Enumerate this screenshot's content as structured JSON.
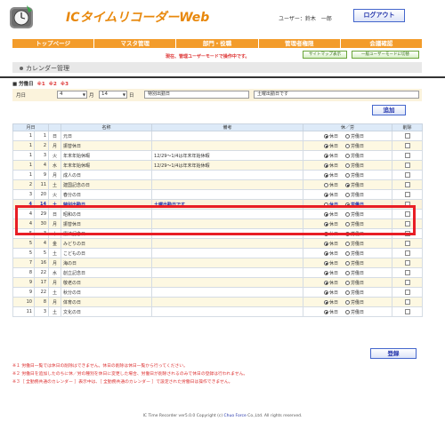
{
  "header": {
    "app_title": "ICタイムリコーダーWeb",
    "user_label": "ユーザー：鈴木　一郎",
    "logout_label": "ログアウト"
  },
  "nav": {
    "items": [
      "トップページ",
      "マスタ管理",
      "部門・役職",
      "管理者権限",
      "会議確認"
    ]
  },
  "toolbar": {
    "notice": "現在、管理ユーザーモードで操作中です。",
    "sitemap_label": "サイトマップ表示",
    "switch_label": "一般ユーザーモードに切替"
  },
  "page": {
    "section_title": "カレンダー管理",
    "legend_title": "■ 労働日",
    "legend_refs": [
      "※1",
      "※2",
      "※3"
    ]
  },
  "form": {
    "month_label": "月日",
    "month_value": "4",
    "month_unit": "月",
    "day_value": "14",
    "day_unit": "日",
    "name_value": "特別出勤日",
    "note_value": "土曜出勤日です",
    "add_label": "追加"
  },
  "table": {
    "headers": [
      "月日",
      "",
      "",
      "名称",
      "備考",
      "休／労",
      "削除"
    ],
    "rows": [
      {
        "m": "1",
        "d": "1",
        "w": "日",
        "name": "元日",
        "note": "",
        "type": "休日"
      },
      {
        "m": "1",
        "d": "2",
        "w": "月",
        "name": "振替休日",
        "note": "",
        "type": "休日"
      },
      {
        "m": "1",
        "d": "3",
        "w": "火",
        "name": "年末年始休暇",
        "note": "12/29〜1/4は年末年始休暇",
        "type": "休日"
      },
      {
        "m": "1",
        "d": "4",
        "w": "水",
        "name": "年末年始休暇",
        "note": "12/29〜1/4は年末年始休暇",
        "type": "休日"
      },
      {
        "m": "1",
        "d": "9",
        "w": "月",
        "name": "成人の日",
        "note": "",
        "type": "休日"
      },
      {
        "m": "2",
        "d": "11",
        "w": "土",
        "name": "建国記念の日",
        "note": "",
        "type": "労働日"
      },
      {
        "m": "3",
        "d": "20",
        "w": "火",
        "name": "春分の日",
        "note": "",
        "type": "休日"
      },
      {
        "m": "4",
        "d": "14",
        "w": "土",
        "name": "特別出勤日",
        "note": "土曜出勤日です",
        "type": "労働日"
      },
      {
        "m": "4",
        "d": "29",
        "w": "日",
        "name": "昭和の日",
        "note": "",
        "type": "休日"
      },
      {
        "m": "4",
        "d": "30",
        "w": "月",
        "name": "振替休日",
        "note": "",
        "type": "休日"
      },
      {
        "m": "5",
        "d": "3",
        "w": "木",
        "name": "憲法記念日",
        "note": "",
        "type": "休日"
      },
      {
        "m": "5",
        "d": "4",
        "w": "金",
        "name": "みどりの日",
        "note": "",
        "type": "休日"
      },
      {
        "m": "5",
        "d": "5",
        "w": "土",
        "name": "こどもの日",
        "note": "",
        "type": "休日"
      },
      {
        "m": "7",
        "d": "16",
        "w": "月",
        "name": "海の日",
        "note": "",
        "type": "休日"
      },
      {
        "m": "8",
        "d": "22",
        "w": "水",
        "name": "創立記念日",
        "note": "",
        "type": "休日"
      },
      {
        "m": "9",
        "d": "17",
        "w": "月",
        "name": "敬老の日",
        "note": "",
        "type": "休日"
      },
      {
        "m": "9",
        "d": "22",
        "w": "土",
        "name": "秋分の日",
        "note": "",
        "type": "休日"
      },
      {
        "m": "10",
        "d": "8",
        "w": "月",
        "name": "体育の日",
        "note": "",
        "type": "休日"
      },
      {
        "m": "11",
        "d": "3",
        "w": "土",
        "name": "文化の日",
        "note": "",
        "type": "休日"
      }
    ],
    "holiday_label": "休日",
    "workday_label": "労働日"
  },
  "actions": {
    "save_label": "登録"
  },
  "notes": [
    "※１ 労働日一覧では休日の削除はできません。休日の削除は休日一覧から行ってください。",
    "※２ 労働日を追加したのちに休／労の種別を休日に変更した場合、労働日が削除されるのみで休日の登録は行われません。",
    "※３［ 全勤務共通のカレンダー ］表示中は、［ 全勤務共通のカレンダー ］で設定された労働日は操作できません。"
  ],
  "footer": {
    "copyright": "IC Time Recorder ver5.0.0 Copyright (c) ",
    "company": "Chuo Force",
    "rights": " Co.,Ltd. All rights reserved."
  }
}
